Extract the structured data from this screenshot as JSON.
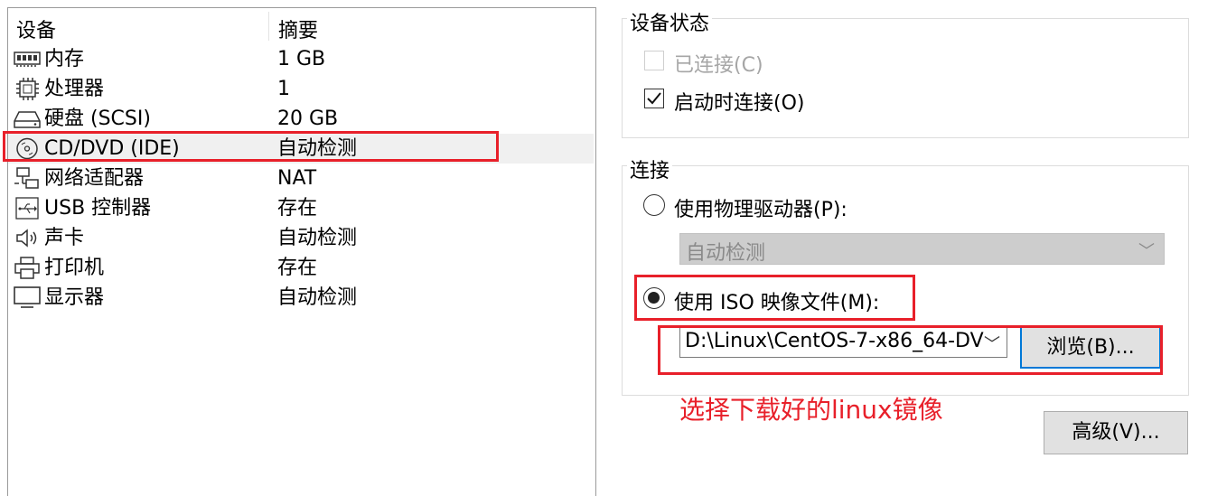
{
  "device_table": {
    "headers": {
      "device": "设备",
      "summary": "摘要"
    },
    "rows": [
      {
        "icon": "memory-icon",
        "name": "内存",
        "summary": "1 GB"
      },
      {
        "icon": "processor-icon",
        "name": "处理器",
        "summary": "1"
      },
      {
        "icon": "hard-disk-icon",
        "name": "硬盘 (SCSI)",
        "summary": "20 GB"
      },
      {
        "icon": "cd-dvd-icon",
        "name": "CD/DVD (IDE)",
        "summary": "自动检测",
        "selected": true
      },
      {
        "icon": "network-adapter-icon",
        "name": "网络适配器",
        "summary": "NAT"
      },
      {
        "icon": "usb-icon",
        "name": "USB 控制器",
        "summary": "存在"
      },
      {
        "icon": "sound-card-icon",
        "name": "声卡",
        "summary": "自动检测"
      },
      {
        "icon": "printer-icon",
        "name": "打印机",
        "summary": "存在"
      },
      {
        "icon": "display-icon",
        "name": "显示器",
        "summary": "自动检测"
      }
    ]
  },
  "device_status": {
    "title": "设备状态",
    "connected": {
      "label": "已连接(C)",
      "checked": false,
      "disabled": true
    },
    "connect_at_power_on": {
      "label": "启动时连接(O)",
      "checked": true
    }
  },
  "connection": {
    "title": "连接",
    "physical_drive": {
      "label": "使用物理驱动器(P):",
      "selected": false,
      "value": "自动检测"
    },
    "iso_image": {
      "label": "使用 ISO 映像文件(M):",
      "selected": true,
      "value": "D:\\Linux\\CentOS-7-x86_64-DV"
    },
    "browse_button": "浏览(B)..."
  },
  "annotation": "选择下载好的linux镜像",
  "advanced_button": "高级(V)...",
  "colors": {
    "highlight_red": "#e8202a",
    "focus_blue": "#0078d7"
  }
}
